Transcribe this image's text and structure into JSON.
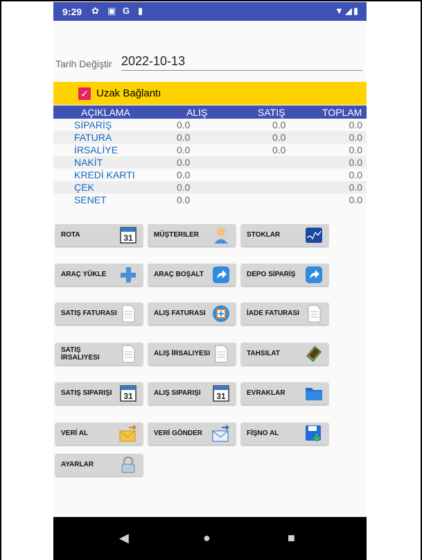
{
  "status_bar": {
    "time": "9:29",
    "icons_left": [
      "gear-icon",
      "a-icon",
      "google-icon",
      "sd-card-icon"
    ],
    "icons_right": [
      "wifi-icon",
      "signal-icon",
      "battery-icon"
    ]
  },
  "date": {
    "label": "Tarih Değiştir",
    "value": "2022-10-13"
  },
  "remote": {
    "label": "Uzak Bağlantı",
    "checked": true
  },
  "table": {
    "headers": [
      "AÇIKLAMA",
      "ALIŞ",
      "SATIŞ",
      "TOPLAM"
    ],
    "rows": [
      {
        "name": "SİPARİŞ",
        "alis": "0.0",
        "satis": "0.0",
        "toplam": "0.0"
      },
      {
        "name": "FATURA",
        "alis": "0.0",
        "satis": "0.0",
        "toplam": "0.0"
      },
      {
        "name": "İRSALİYE",
        "alis": "0.0",
        "satis": "0.0",
        "toplam": "0.0"
      },
      {
        "name": "NAKİT",
        "alis": "0.0",
        "satis": "",
        "toplam": "0.0"
      },
      {
        "name": "KREDİ KARTI",
        "alis": "0.0",
        "satis": "",
        "toplam": "0.0"
      },
      {
        "name": "ÇEK",
        "alis": "0.0",
        "satis": "",
        "toplam": "0.0"
      },
      {
        "name": "SENET",
        "alis": "0.0",
        "satis": "",
        "toplam": "0.0"
      }
    ]
  },
  "buttons": [
    {
      "label": "ROTA",
      "icon": "calendar-icon"
    },
    {
      "label": "MÜŞTERILER",
      "icon": "person-icon"
    },
    {
      "label": "STOKLAR",
      "icon": "stock-chart-icon"
    },
    {
      "label": "ARAÇ YÜKLE",
      "icon": "plus-icon"
    },
    {
      "label": "ARAÇ BOŞALT",
      "icon": "share-arrow-icon"
    },
    {
      "label": "DEPO SİPARİŞ",
      "icon": "share-arrow-icon"
    },
    {
      "label": "SATIŞ FATURASI",
      "icon": "document-icon"
    },
    {
      "label": "ALIŞ FATURASI",
      "icon": "add-document-icon"
    },
    {
      "label": "İADE FATURASI",
      "icon": "document-icon"
    },
    {
      "label": "SATIŞ İRSALIYESI",
      "icon": "document-icon"
    },
    {
      "label": "ALIŞ İRSALIYESI",
      "icon": "document-icon"
    },
    {
      "label": "TAHSILAT",
      "icon": "money-icon"
    },
    {
      "label": "SATIŞ SIPARIŞI",
      "icon": "calendar-icon"
    },
    {
      "label": "ALIŞ SIPARIŞI",
      "icon": "calendar-icon"
    },
    {
      "label": "EVRAKLAR",
      "icon": "folder-icon"
    },
    {
      "label": "VERİ AL",
      "icon": "mail-in-icon"
    },
    {
      "label": "VERİ GÖNDER",
      "icon": "mail-out-icon"
    },
    {
      "label": "FİŞNO AL",
      "icon": "save-download-icon"
    },
    {
      "label": "AYARLAR",
      "icon": "lock-icon"
    }
  ],
  "calendar_day": "31",
  "colors": {
    "status_bar": "#3f51b5",
    "table_header": "#3f51b5",
    "remote_bar": "#fed300",
    "checkbox": "#e91e63",
    "row_label": "#1565c0"
  }
}
